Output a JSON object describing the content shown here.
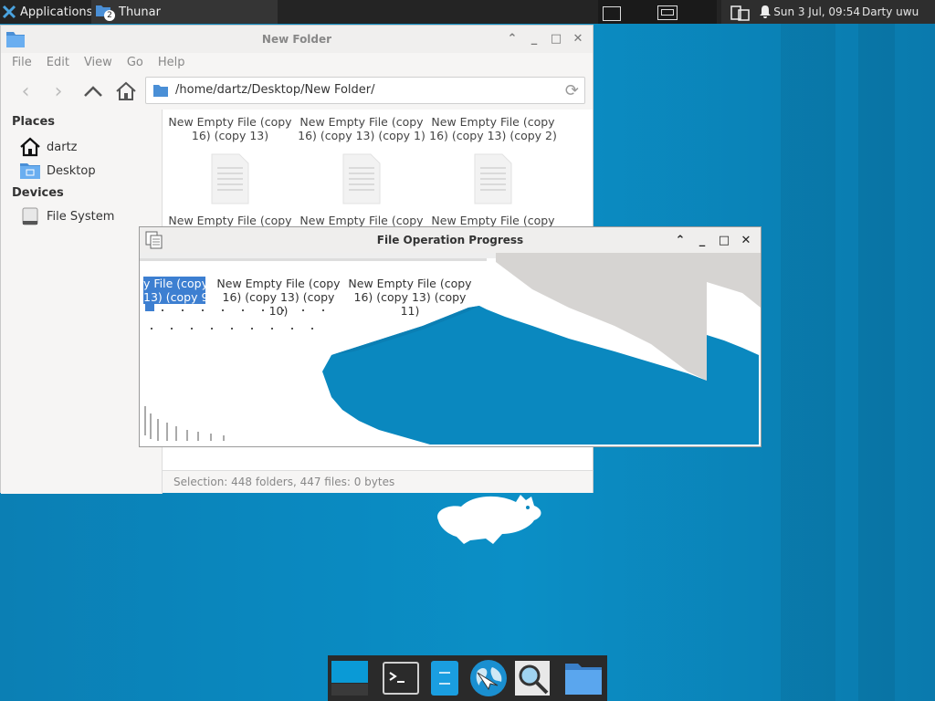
{
  "top_panel": {
    "applications_label": "Applications",
    "task_label": "Thunar",
    "task_badge": "2",
    "clock": "Sun  3 Jul, 09:54",
    "user": "Darty uwu"
  },
  "thunar": {
    "title": "New Folder",
    "menu": [
      "File",
      "Edit",
      "View",
      "Go",
      "Help"
    ],
    "location": "/home/dartz/Desktop/New Folder/",
    "places_heading": "Places",
    "places": [
      "dartz",
      "Desktop"
    ],
    "devices_heading": "Devices",
    "devices": [
      "File System"
    ],
    "files": [
      {
        "line1": "New Empty File (copy",
        "line2": "16) (copy 13)"
      },
      {
        "line1": "New Empty File (copy",
        "line2": "16) (copy 13) (copy 1)"
      },
      {
        "line1": "New Empty File (copy",
        "line2": "16) (copy 13) (copy 2)"
      },
      {
        "line1": "New Empty File (copy",
        "line2": ""
      },
      {
        "line1": "New Empty File (copy",
        "line2": ""
      },
      {
        "line1": "New Empty File (copy",
        "line2": ""
      }
    ],
    "status": "Selection: 448 folders, 447 files: 0 bytes"
  },
  "progress_window": {
    "title": "File Operation Progress",
    "ghost_items": [
      {
        "line1": "y File (copy",
        "line2": "13) (copy 9)"
      },
      {
        "line1": "New Empty File (copy",
        "line2": "16) (copy 13) (copy 10)"
      },
      {
        "line1": "New Empty File (copy",
        "line2": "16) (copy 13) (copy 11)"
      }
    ]
  },
  "colors": {
    "accent": "#3d7fd1",
    "wallpaper": "#0a88bf",
    "panel": "#242424"
  },
  "dock": [
    "workspace-switcher-icon",
    "terminal-icon",
    "file-manager-pane-icon",
    "web-browser-icon",
    "app-finder-icon",
    "folder-icon"
  ]
}
